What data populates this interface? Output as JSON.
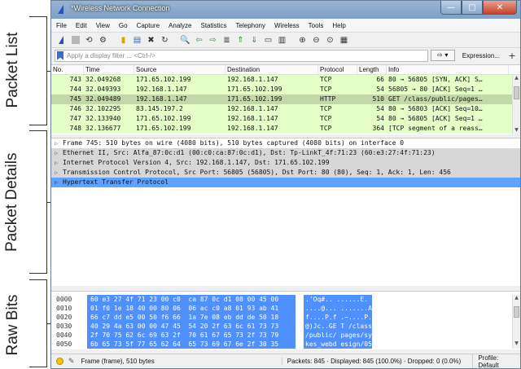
{
  "annotations": [
    "Packet List",
    "Packet Details",
    "Raw Bits"
  ],
  "window": {
    "title": "*Wireless Network Connection"
  },
  "menu": [
    "File",
    "Edit",
    "View",
    "Go",
    "Capture",
    "Analyze",
    "Statistics",
    "Telephony",
    "Wireless",
    "Tools",
    "Help"
  ],
  "filter": {
    "placeholder": "Apply a display filter ... <Ctrl-/>",
    "expression_label": "Expression...",
    "plus_label": "+"
  },
  "packet_list": {
    "columns": [
      "No.",
      "Time",
      "Source",
      "Destination",
      "Protocol",
      "Length",
      "Info"
    ],
    "rows": [
      {
        "no": "743",
        "time": "32.049268",
        "src": "171.65.102.199",
        "dst": "192.168.1.147",
        "proto": "TCP",
        "len": "66",
        "info": "80 → 56805 [SYN, ACK] S…"
      },
      {
        "no": "744",
        "time": "32.049393",
        "src": "192.168.1.147",
        "dst": "171.65.102.199",
        "proto": "TCP",
        "len": "54",
        "info": "56805 → 80 [ACK] Seq=1 …"
      },
      {
        "no": "745",
        "time": "32.049489",
        "src": "192.168.1.147",
        "dst": "171.65.102.199",
        "proto": "HTTP",
        "len": "510",
        "info": "GET /class/public/pages…"
      },
      {
        "no": "746",
        "time": "32.102295",
        "src": "83.145.197.2",
        "dst": "192.168.1.147",
        "proto": "TCP",
        "len": "54",
        "info": "80 → 56803 [ACK] Seq=10…"
      },
      {
        "no": "747",
        "time": "32.133940",
        "src": "171.65.102.199",
        "dst": "192.168.1.147",
        "proto": "TCP",
        "len": "54",
        "info": "80 → 56805 [ACK] Seq=1 …"
      },
      {
        "no": "748",
        "time": "32.136677",
        "src": "171.65.102.199",
        "dst": "192.168.1.147",
        "proto": "TCP",
        "len": "364",
        "info": "[TCP segment of a reass…"
      }
    ]
  },
  "details": [
    "Frame 745: 510 bytes on wire (4080 bits), 510 bytes captured (4080 bits) on interface 0",
    "Ethernet II, Src: Alfa_87:0c:d1 (00:c0:ca:87:0c:d1), Dst: Tp-LinkT_4f:71:23 (60:e3:27:4f:71:23)",
    "Internet Protocol Version 4, Src: 192.168.1.147, Dst: 171.65.102.199",
    "Transmission Control Protocol, Src Port: 56805 (56805), Dst Port: 80 (80), Seq: 1, Ack: 1, Len: 456",
    "Hypertext Transfer Protocol"
  ],
  "bytes": [
    {
      "off": "0000",
      "hex": "60 e3 27 4f 71 23 00 c0  ca 87 0c d1 08 00 45 00",
      "ascii": ".'Oq#.. ......E."
    },
    {
      "off": "0010",
      "hex": "01 f0 1e 18 40 00 80 06  06 ac c0 a8 01 93 ab 41",
      "ascii": "....@... .......A"
    },
    {
      "off": "0020",
      "hex": "66 c7 dd e5 00 50 f6 66  1a 7e 08 eb dd de 50 18",
      "ascii": "f....P.f .~....P."
    },
    {
      "off": "0030",
      "hex": "40 29 4a 63 00 00 47 45  54 20 2f 63 6c 61 73 73",
      "ascii": "@)Jc..GE T /class"
    },
    {
      "off": "0040",
      "hex": "2f 70 75 62 6c 69 63 2f  70 61 67 65 73 2f 73 79",
      "ascii": "/public/ pages/sy"
    },
    {
      "off": "0050",
      "hex": "6b 65 73 5f 77 65 62 64  65 73 69 67 6e 2f 30 35",
      "ascii": "kes_webd esign/05"
    }
  ],
  "status": {
    "frame": "Frame (frame), 510 bytes",
    "packets": "Packets: 845 · Displayed: 845 (100.0%) · Dropped: 0 (0.0%)",
    "profile": "Profile: Default"
  }
}
